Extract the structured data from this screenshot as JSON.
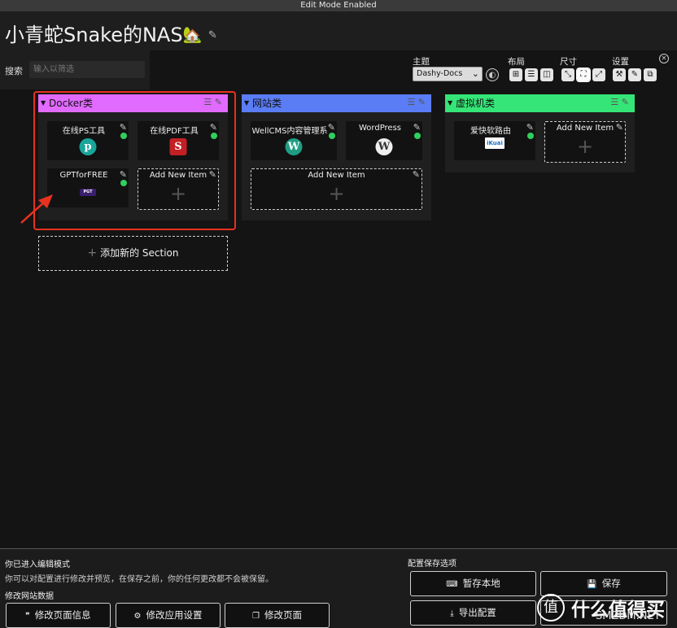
{
  "topbar": {
    "text": "Edit Mode Enabled"
  },
  "header": {
    "title": "小青蛇Snake的NAS",
    "title_emoji": "🏡",
    "edit_glyph": "✎"
  },
  "search": {
    "label": "搜索",
    "placeholder": "输入以筛选"
  },
  "config": {
    "theme_label": "主题",
    "theme_value": "Dashy-Docs",
    "layout_label": "布局",
    "size_label": "尺寸",
    "settings_label": "设置",
    "icons": [
      "palette-icon",
      "layout-auto-icon",
      "layout-horizontal-icon",
      "layout-vertical-icon",
      "size-small-icon",
      "size-medium-icon",
      "size-large-icon",
      "wrench-icon",
      "pencil-icon",
      "config-export-icon"
    ]
  },
  "sections": [
    {
      "name": "Docker类",
      "color": "#e16aff",
      "items": [
        {
          "name": "在线PS工具",
          "icon": "photopea-logo",
          "glyph": "p",
          "color": "#19a59a"
        },
        {
          "name": "在线PDF工具",
          "icon": "stirling-pdf-logo",
          "glyph": "S",
          "color": "#c22024"
        },
        {
          "name": "GPTforFREE",
          "icon": "gptforfree-logo",
          "glyph": "PGT",
          "color": "#3a1f6e"
        }
      ],
      "add_label": "Add New Item"
    },
    {
      "name": "网站类",
      "color": "#5a7cf5",
      "items": [
        {
          "name": "WellCMS内容管理系",
          "icon": "wellcms-logo",
          "glyph": "W",
          "color": "#1f9e83"
        },
        {
          "name": "WordPress",
          "icon": "wordpress-logo",
          "glyph": "W",
          "color": "#eeeeee"
        }
      ],
      "add_label": "Add New Item"
    },
    {
      "name": "虚拟机类",
      "color": "#35e577",
      "items": [
        {
          "name": "爱快软路由",
          "icon": "ikuai-logo",
          "glyph": "iKuai",
          "color": "#1a6fc0"
        }
      ],
      "add_label": "Add New Item"
    }
  ],
  "add_section_label": "添加新的 Section",
  "footer": {
    "edit_title": "你已进入编辑模式",
    "edit_desc": "你可以对配置进行修改并预览，在保存之前，你的任何更改都不会被保留。",
    "site_data_title": "修改网站数据",
    "site_buttons": [
      "修改页面信息",
      "修改应用设置",
      "修改页面"
    ],
    "save_title": "配置保存选项",
    "save_local": "暂存本地",
    "save": "保存",
    "export": "导出配置"
  },
  "watermark": {
    "icon_glyph": "值",
    "main": "什么值得买",
    "sub": "SMZDM.NET"
  }
}
